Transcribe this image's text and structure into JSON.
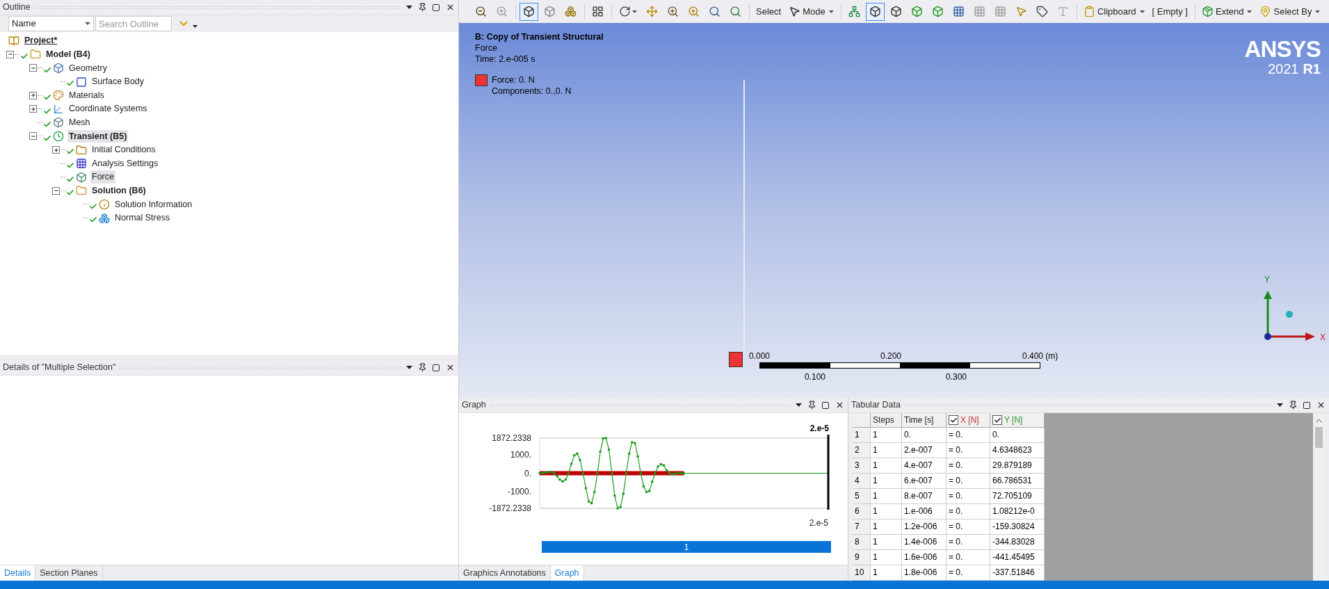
{
  "outline": {
    "title": "Outline",
    "filter": {
      "value": "Name"
    },
    "search": {
      "placeholder": "Search Outline"
    },
    "tree": [
      {
        "label": "Project*",
        "kind": "project",
        "bold": true,
        "underline": true,
        "selected": false,
        "children": [
          {
            "label": "Model (B4)",
            "kind": "model",
            "bold": true,
            "selected": false,
            "expanded": true,
            "checked": true,
            "children": [
              {
                "label": "Geometry",
                "kind": "geometry",
                "bold": false,
                "selected": false,
                "expanded": true,
                "checked": true,
                "children": [
                  {
                    "label": "Surface Body",
                    "kind": "body",
                    "bold": false,
                    "selected": false,
                    "checked": true
                  }
                ]
              },
              {
                "label": "Materials",
                "kind": "materials",
                "bold": false,
                "selected": false,
                "expanded": false,
                "checked": true
              },
              {
                "label": "Coordinate Systems",
                "kind": "coords",
                "bold": false,
                "selected": false,
                "expanded": false,
                "checked": true
              },
              {
                "label": "Mesh",
                "kind": "mesh",
                "bold": false,
                "selected": false,
                "checked": true
              },
              {
                "label": "Transient (B5)",
                "kind": "analysis",
                "bold": true,
                "selected": true,
                "expanded": true,
                "checked": true,
                "children": [
                  {
                    "label": "Initial Conditions",
                    "kind": "initial",
                    "bold": false,
                    "selected": false,
                    "expanded": false,
                    "checked": true
                  },
                  {
                    "label": "Analysis Settings",
                    "kind": "settings",
                    "bold": false,
                    "selected": false,
                    "checked": true
                  },
                  {
                    "label": "Force",
                    "kind": "load",
                    "bold": false,
                    "selected": true,
                    "checked": true
                  },
                  {
                    "label": "Solution (B6)",
                    "kind": "solution",
                    "bold": true,
                    "selected": false,
                    "expanded": true,
                    "checked": true,
                    "children": [
                      {
                        "label": "Solution Information",
                        "kind": "info",
                        "bold": false,
                        "selected": false,
                        "checked": true
                      },
                      {
                        "label": "Normal Stress",
                        "kind": "result",
                        "bold": false,
                        "selected": false,
                        "checked": true
                      }
                    ]
                  }
                ]
              }
            ]
          }
        ]
      }
    ]
  },
  "details": {
    "title": "Details of \"Multiple Selection\"",
    "tabs": [
      {
        "label": "Details",
        "selected": true
      },
      {
        "label": "Section Planes",
        "selected": false
      }
    ]
  },
  "toolbar": [
    {
      "items": [
        {
          "kind": "icon",
          "selected": false
        },
        {
          "kind": "icon",
          "selected": false
        }
      ]
    },
    {
      "items": [
        {
          "kind": "icon",
          "selected": true
        },
        {
          "kind": "icon",
          "selected": false
        },
        {
          "kind": "icon",
          "selected": false
        }
      ]
    },
    {
      "items": [
        {
          "kind": "icon",
          "selected": false
        }
      ]
    },
    {
      "items": [
        {
          "kind": "icon",
          "selected": false,
          "dropdown": true
        },
        {
          "kind": "icon",
          "selected": false
        },
        {
          "kind": "icon",
          "selected": false
        },
        {
          "kind": "icon",
          "selected": false
        },
        {
          "kind": "icon",
          "selected": false
        },
        {
          "kind": "icon",
          "selected": false
        }
      ]
    },
    {
      "items": [
        {
          "kind": "text",
          "label": "Select"
        },
        {
          "kind": "icon_text",
          "label": "Mode",
          "dropdown": true
        }
      ]
    },
    {
      "items": [
        {
          "kind": "icon",
          "selected": false
        },
        {
          "kind": "icon",
          "selected": true
        },
        {
          "kind": "icon",
          "selected": false
        },
        {
          "kind": "icon",
          "selected": false
        },
        {
          "kind": "icon",
          "selected": false
        },
        {
          "kind": "icon",
          "selected": false
        },
        {
          "kind": "icon",
          "selected": false
        },
        {
          "kind": "icon",
          "selected": false
        },
        {
          "kind": "icon",
          "selected": false
        },
        {
          "kind": "icon",
          "selected": false
        },
        {
          "kind": "icon",
          "selected": false
        }
      ]
    },
    {
      "items": [
        {
          "kind": "icon_text",
          "label": "Clipboard",
          "dropdown": true
        },
        {
          "kind": "text",
          "label": "[ Empty ]"
        }
      ]
    },
    {
      "items": [
        {
          "kind": "icon_text",
          "label": "Extend",
          "dropdown": true
        },
        {
          "kind": "icon_text",
          "label": "Select By",
          "dropdown": true
        }
      ]
    }
  ],
  "viewport": {
    "title": "B: Copy of Transient Structural",
    "subtitle": "Force",
    "time": "Time: 2.e-005 s",
    "legend": {
      "color": "#ee3333",
      "label": "Force: 0. N",
      "detail": "Components: 0.,0. N"
    },
    "logo": {
      "name": "ANSYS",
      "version": "2021",
      "release": "R1"
    },
    "scale": {
      "top_labels": [
        "0.000",
        "0.200",
        "0.400 (m)"
      ],
      "bottom_labels": [
        "0.100",
        "0.300"
      ]
    },
    "triad": {
      "y_label": "Y",
      "x_label": "X"
    }
  },
  "graph": {
    "title": "Graph",
    "marker_label": "2.e-5",
    "step_bar": "1",
    "y_ticks": [
      "1872.2338",
      "1000.",
      "0.",
      "-1000.",
      "-1872.2338"
    ],
    "x_end_label": "2.e-5",
    "tabs": [
      {
        "label": "Graphics Annotations",
        "selected": false
      },
      {
        "label": "Graph",
        "selected": true
      }
    ]
  },
  "tabular": {
    "title": "Tabular Data",
    "columns": [
      {
        "kind": "corner"
      },
      {
        "label": "Steps",
        "kind": "plain"
      },
      {
        "label": "Time [s]",
        "kind": "plain"
      },
      {
        "label": "X [N]",
        "kind": "check",
        "checked": true,
        "color": "#d03030"
      },
      {
        "label": "Y [N]",
        "kind": "check",
        "checked": true,
        "color": "#2a9a2a"
      }
    ],
    "rows": [
      [
        "1",
        "1",
        "0.",
        "= 0.",
        "0."
      ],
      [
        "2",
        "1",
        "2.e-007",
        "= 0.",
        "4.6348623"
      ],
      [
        "3",
        "1",
        "4.e-007",
        "= 0.",
        "29.879189"
      ],
      [
        "4",
        "1",
        "6.e-007",
        "= 0.",
        "66.786531"
      ],
      [
        "5",
        "1",
        "8.e-007",
        "= 0.",
        "72.705109"
      ],
      [
        "6",
        "1",
        "1.e-006",
        "= 0.",
        "1.08212e-0"
      ],
      [
        "7",
        "1",
        "1.2e-006",
        "= 0.",
        "-159.30824"
      ],
      [
        "8",
        "1",
        "1.4e-006",
        "= 0.",
        "-344.83028"
      ],
      [
        "9",
        "1",
        "1.6e-006",
        "= 0.",
        "-441.45495"
      ],
      [
        "10",
        "1",
        "1.8e-006",
        "= 0.",
        "-337.51846"
      ]
    ]
  }
}
